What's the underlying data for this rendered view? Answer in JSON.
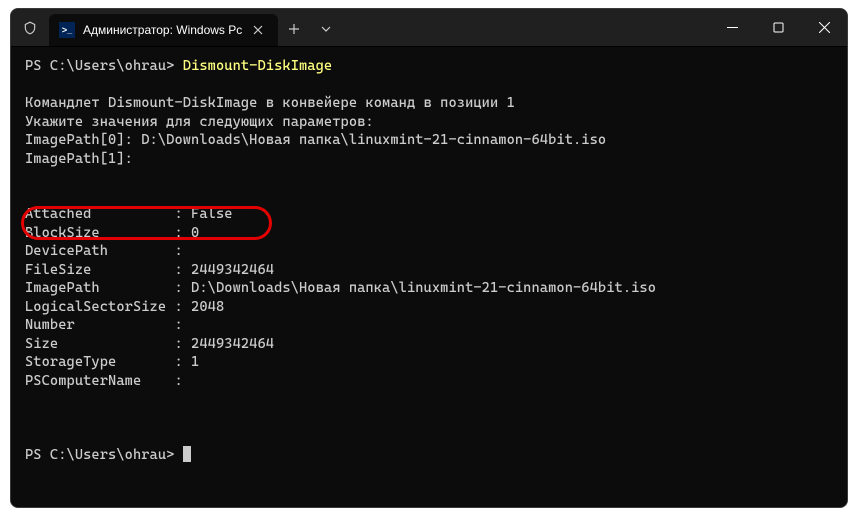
{
  "tab": {
    "title": "Администратор: Windows Pc"
  },
  "prompt1": {
    "path": "PS C:\\Users\\ohrau> ",
    "command": "Dismount-DiskImage"
  },
  "body": {
    "l1": "Командлет Dismount-DiskImage в конвейере команд в позиции 1",
    "l2": "Укажите значения для следующих параметров:",
    "l3": "ImagePath[0]: D:\\Downloads\\Новая папка\\linuxmint-21-cinnamon-64bit.iso",
    "l4": "ImagePath[1]:"
  },
  "output": {
    "r1": "Attached          : False",
    "r2": "BlockSize         : 0",
    "r3": "DevicePath        :",
    "r4": "FileSize          : 2449342464",
    "r5": "ImagePath         : D:\\Downloads\\Новая папка\\linuxmint-21-cinnamon-64bit.iso",
    "r6": "LogicalSectorSize : 2048",
    "r7": "Number            :",
    "r8": "Size              : 2449342464",
    "r9": "StorageType       : 1",
    "r10": "PSComputerName    :"
  },
  "prompt2": {
    "path": "PS C:\\Users\\ohrau> "
  }
}
